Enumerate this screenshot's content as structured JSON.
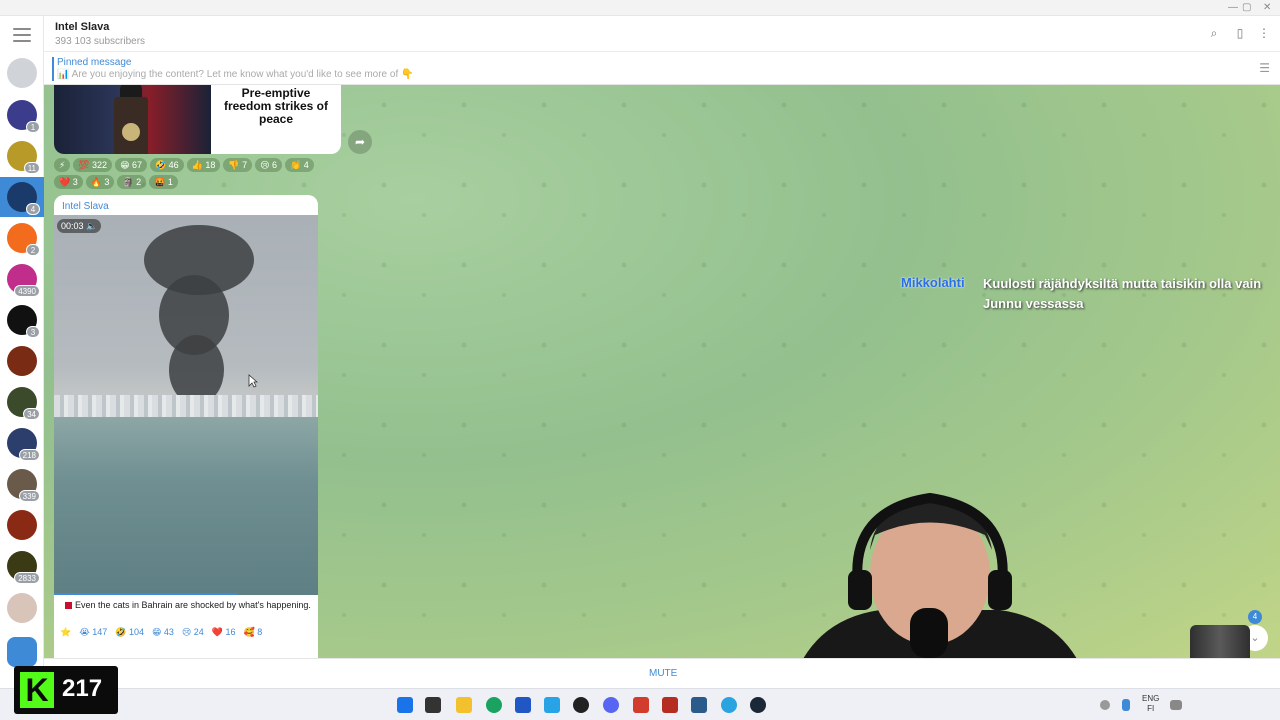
{
  "channel": {
    "title": "Intel Slava",
    "subscribers": "393 103 subscribers"
  },
  "pinned": {
    "title": "Pinned message",
    "text": "📊 Are you enjoying the content? Let me know what you'd like to see more of 👇"
  },
  "message1": {
    "caption": "Pre-emptive freedom strikes of peace",
    "reactions": [
      "⚡",
      "💯 322",
      "😁 67",
      "🤣 46",
      "👍 18",
      "👎 7",
      "😢 6",
      "👏 4",
      "❤️ 3",
      "🔥 3",
      "🗿 2",
      "🤬 1"
    ]
  },
  "message2": {
    "author": "Intel Slava",
    "video_time": "00:03",
    "text": "Even the cats in Bahrain are shocked by what's happening.",
    "reactions": [
      "⭐",
      "😭 147",
      "🤣 104",
      "😁 43",
      "😢 24",
      "❤️ 16",
      "🥰 8"
    ]
  },
  "rail_badges": [
    "",
    "1",
    "11",
    "4",
    "2",
    "4390",
    "3",
    "",
    "34",
    "218",
    "339",
    "",
    "2833",
    ""
  ],
  "scroll": {
    "badge": "4"
  },
  "overlay": {
    "username": "Mikkolahti",
    "message": "Kuulosti räjähdyksiltä mutta taisikin olla vain Junnu vessassa"
  },
  "mutebar": {
    "label": "MUTE"
  },
  "counter": {
    "logo": "K",
    "value": "217"
  },
  "taskbar": {
    "lang": "ENG",
    "region": "FI"
  },
  "colors": {
    "accent": "#3f8ad6",
    "kick_green": "#53fc18"
  }
}
